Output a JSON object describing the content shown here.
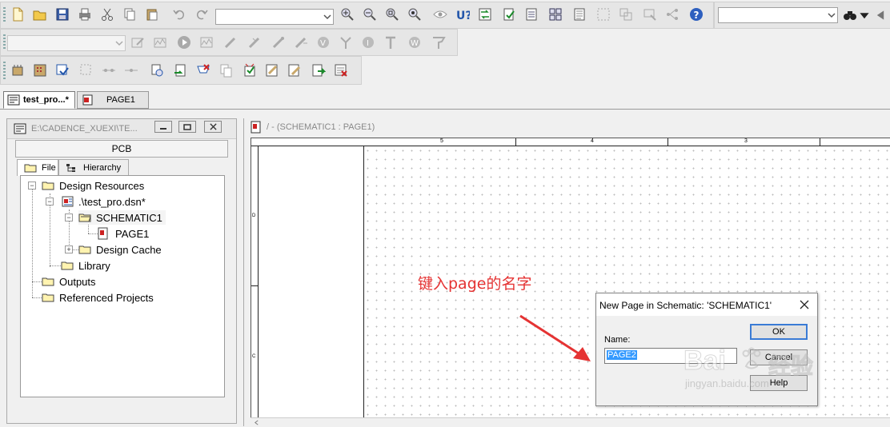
{
  "toolbar1": {
    "icons": [
      "new-file",
      "open-folder",
      "save",
      "print",
      "cut",
      "copy",
      "paste",
      "undo",
      "redo",
      "zoom-in",
      "zoom-out",
      "zoom-area",
      "zoom-all",
      "view",
      "u-help",
      "annotate",
      "drc",
      "bom",
      "netlist",
      "cross-ref",
      "part-grid",
      "part-props",
      "part-update",
      "hierarchy",
      "help-circle"
    ],
    "combo_value": "",
    "search_value": ""
  },
  "toolbar2": {
    "combo_value": "",
    "icons": [
      "sim-profile",
      "sim-edit",
      "sim-run",
      "sim-results",
      "probe-voltage",
      "probe-current",
      "probe-diff",
      "probe-power",
      "probe-v",
      "probe-t-marker",
      "probe-i",
      "probe-w",
      "probe-flag",
      "probe-marker"
    ]
  },
  "toolbar3": {
    "icons": [
      "place-part",
      "place-wire",
      "place-net",
      "place-bus",
      "place-junction",
      "place-bus-entry",
      "place-netalias",
      "place-power",
      "place-gnd",
      "place-offpage",
      "place-pin",
      "place-text",
      "place-check",
      "place-delete"
    ]
  },
  "tabs": [
    {
      "label": "test_pro...*",
      "active": true
    },
    {
      "label": "PAGE1",
      "active": false
    }
  ],
  "project_panel": {
    "title": "E:\\CADENCE_XUEXI\\TE...",
    "header": "PCB",
    "tab_file": "File",
    "tab_hierarchy": "Hierarchy",
    "tree": {
      "design_resources": "Design Resources",
      "dsn": ".\\test_pro.dsn*",
      "schematic": "SCHEMATIC1",
      "page": "PAGE1",
      "design_cache": "Design Cache",
      "library": "Library",
      "outputs": "Outputs",
      "referenced": "Referenced Projects"
    }
  },
  "schematic": {
    "title": "/ - (SCHEMATIC1 : PAGE1)",
    "ruler": [
      "5",
      "4",
      "3"
    ],
    "row_labels": [
      "D",
      "C"
    ]
  },
  "annotation": {
    "text": "键入page的名字",
    "color": "#e53333"
  },
  "dialog": {
    "title": "New Page in Schematic:  'SCHEMATIC1'",
    "name_label": "Name:",
    "name_value": "PAGE2",
    "ok": "OK",
    "cancel": "Cancel",
    "help": "Help"
  },
  "watermark": {
    "brand": "Bai",
    "brand_cn": "经验",
    "url": "jingyan.baidu.com"
  }
}
